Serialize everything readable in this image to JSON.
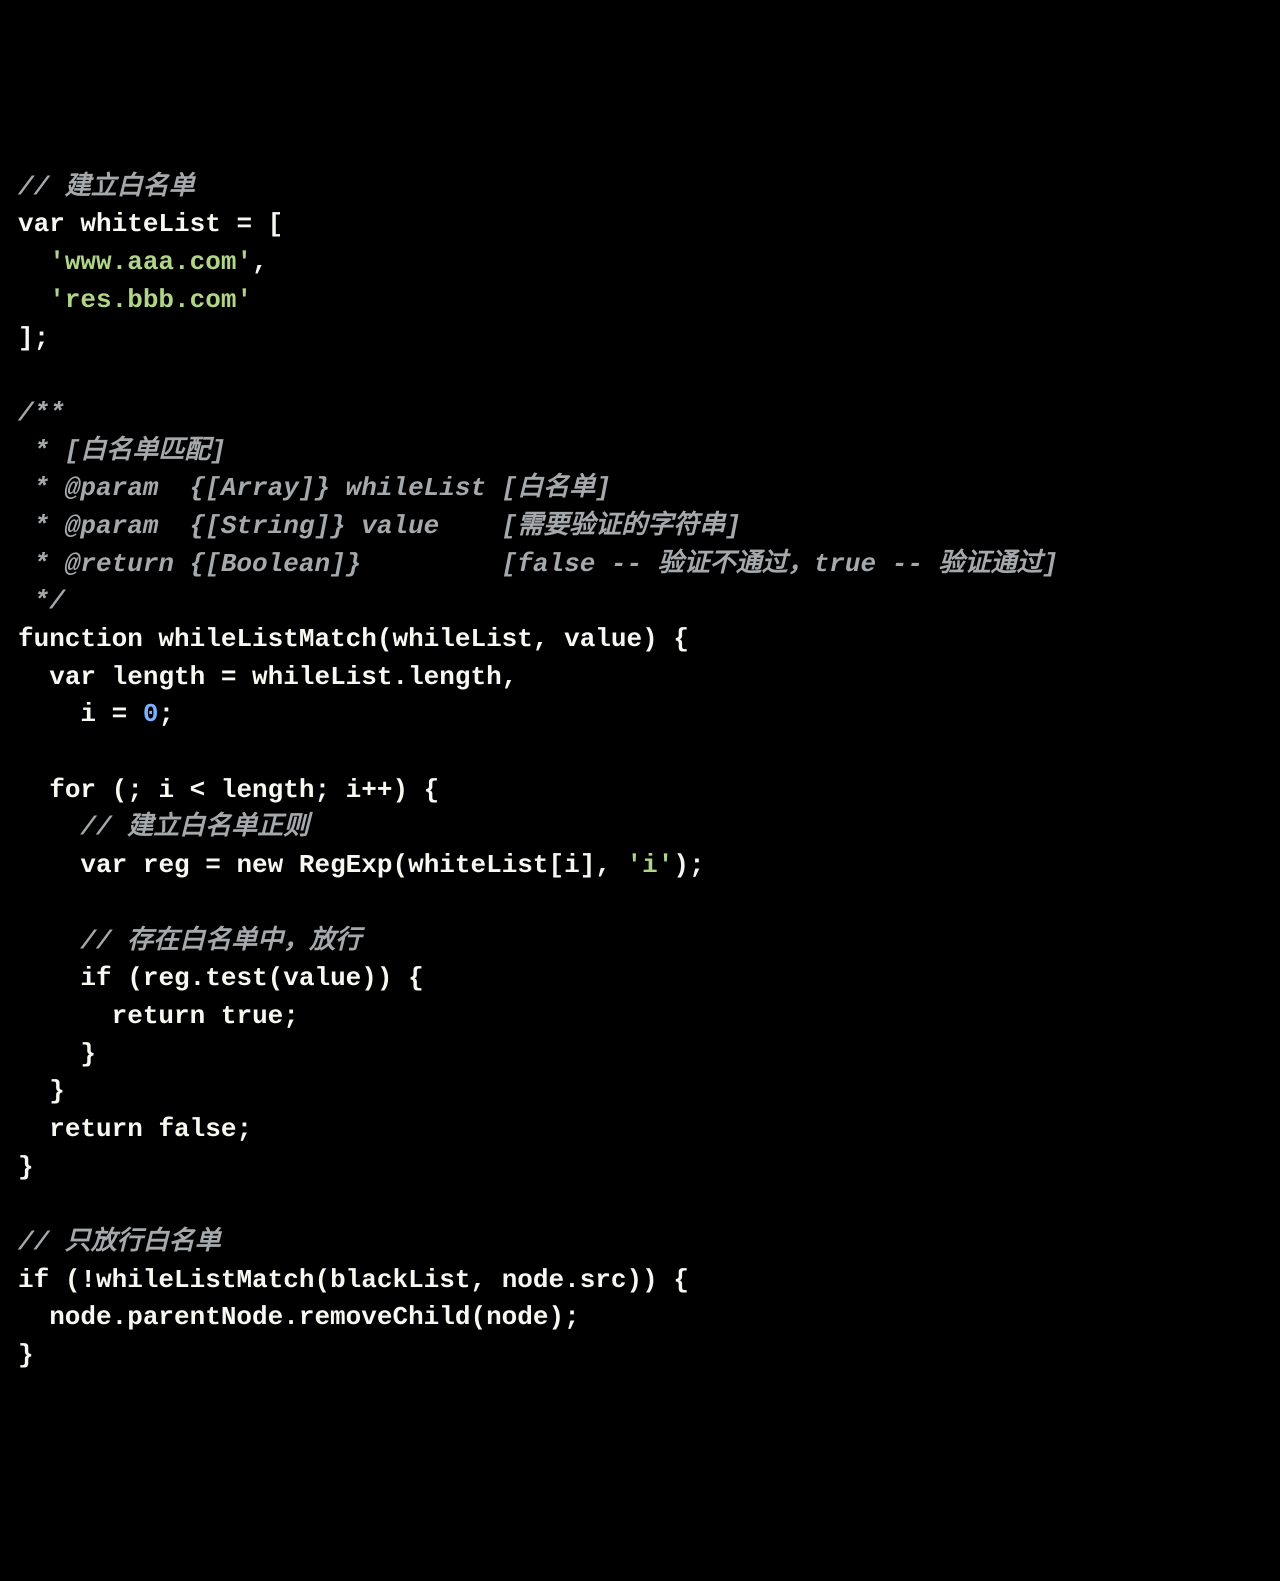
{
  "code": {
    "lines": [
      [
        {
          "cls": "comment",
          "text": "// 建立白名单"
        }
      ],
      [
        {
          "cls": "keyword",
          "text": "var"
        },
        {
          "cls": "plain",
          "text": " whiteList = ["
        }
      ],
      [
        {
          "cls": "plain",
          "text": "  "
        },
        {
          "cls": "string",
          "text": "'www.aaa.com'"
        },
        {
          "cls": "plain",
          "text": ","
        }
      ],
      [
        {
          "cls": "plain",
          "text": "  "
        },
        {
          "cls": "string",
          "text": "'res.bbb.com'"
        }
      ],
      [
        {
          "cls": "plain",
          "text": "];"
        }
      ],
      [
        {
          "cls": "plain",
          "text": ""
        }
      ],
      [
        {
          "cls": "comment",
          "text": "/**"
        }
      ],
      [
        {
          "cls": "comment",
          "text": " * [白名单匹配]"
        }
      ],
      [
        {
          "cls": "comment",
          "text": " * @param  {[Array]} whileList [白名单]"
        }
      ],
      [
        {
          "cls": "comment",
          "text": " * @param  {[String]} value    [需要验证的字符串]"
        }
      ],
      [
        {
          "cls": "comment",
          "text": " * @return {[Boolean]}         [false -- 验证不通过，true -- 验证通过]"
        }
      ],
      [
        {
          "cls": "comment",
          "text": " */"
        }
      ],
      [
        {
          "cls": "keyword",
          "text": "function"
        },
        {
          "cls": "plain",
          "text": " whileListMatch(whileList, value) {"
        }
      ],
      [
        {
          "cls": "plain",
          "text": "  "
        },
        {
          "cls": "keyword",
          "text": "var"
        },
        {
          "cls": "plain",
          "text": " length = whileList.length,"
        }
      ],
      [
        {
          "cls": "plain",
          "text": "    i = "
        },
        {
          "cls": "number",
          "text": "0"
        },
        {
          "cls": "plain",
          "text": ";"
        }
      ],
      [
        {
          "cls": "plain",
          "text": ""
        }
      ],
      [
        {
          "cls": "plain",
          "text": "  "
        },
        {
          "cls": "keyword",
          "text": "for"
        },
        {
          "cls": "plain",
          "text": " (; i < length; i++) {"
        }
      ],
      [
        {
          "cls": "plain",
          "text": "    "
        },
        {
          "cls": "comment",
          "text": "// 建立白名单正则"
        }
      ],
      [
        {
          "cls": "plain",
          "text": "    "
        },
        {
          "cls": "keyword",
          "text": "var"
        },
        {
          "cls": "plain",
          "text": " reg = "
        },
        {
          "cls": "keyword",
          "text": "new"
        },
        {
          "cls": "plain",
          "text": " RegExp(whiteList[i], "
        },
        {
          "cls": "string",
          "text": "'i'"
        },
        {
          "cls": "plain",
          "text": ");"
        }
      ],
      [
        {
          "cls": "plain",
          "text": ""
        }
      ],
      [
        {
          "cls": "plain",
          "text": "    "
        },
        {
          "cls": "comment",
          "text": "// 存在白名单中，放行"
        }
      ],
      [
        {
          "cls": "plain",
          "text": "    "
        },
        {
          "cls": "keyword",
          "text": "if"
        },
        {
          "cls": "plain",
          "text": " (reg.test(value)) {"
        }
      ],
      [
        {
          "cls": "plain",
          "text": "      "
        },
        {
          "cls": "keyword",
          "text": "return"
        },
        {
          "cls": "plain",
          "text": " "
        },
        {
          "cls": "keyword",
          "text": "true"
        },
        {
          "cls": "plain",
          "text": ";"
        }
      ],
      [
        {
          "cls": "plain",
          "text": "    }"
        }
      ],
      [
        {
          "cls": "plain",
          "text": "  }"
        }
      ],
      [
        {
          "cls": "plain",
          "text": "  "
        },
        {
          "cls": "keyword",
          "text": "return"
        },
        {
          "cls": "plain",
          "text": " "
        },
        {
          "cls": "keyword",
          "text": "false"
        },
        {
          "cls": "plain",
          "text": ";"
        }
      ],
      [
        {
          "cls": "plain",
          "text": "}"
        }
      ],
      [
        {
          "cls": "plain",
          "text": ""
        }
      ],
      [
        {
          "cls": "comment",
          "text": "// 只放行白名单"
        }
      ],
      [
        {
          "cls": "keyword",
          "text": "if"
        },
        {
          "cls": "plain",
          "text": " (!whileListMatch(blackList, node.src)) {"
        }
      ],
      [
        {
          "cls": "plain",
          "text": "  node.parentNode.removeChild(node);"
        }
      ],
      [
        {
          "cls": "plain",
          "text": "}"
        }
      ]
    ]
  }
}
